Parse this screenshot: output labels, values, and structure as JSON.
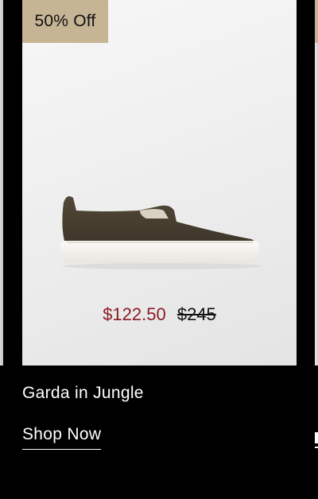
{
  "product": {
    "badge": "50% Off",
    "sale_price": "$122.50",
    "original_price": "$245",
    "name": "Garda in Jungle",
    "cta_label": "Shop Now",
    "image_icon": "slip-on-sneaker-icon"
  },
  "colors": {
    "badge_background": "#c6b595",
    "sale_price": "#8b1c24",
    "page_background": "#000000",
    "shoe_upper": "#4a4133",
    "sole": "#f4f2ee"
  }
}
